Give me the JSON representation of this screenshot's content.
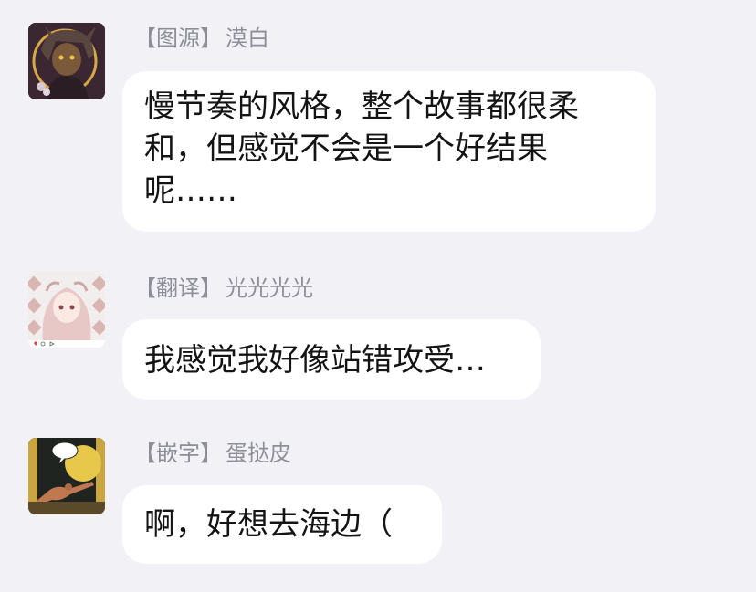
{
  "messages": [
    {
      "role_tag": "【图源】",
      "name": "漠白",
      "text": "慢节奏的风格，整个故事都很柔和，但感觉不会是一个好结果呢……",
      "avatar": "avatar-dark-hair-character-icon"
    },
    {
      "role_tag": "【翻译】",
      "name": "光光光光",
      "text": "我感觉我好像站错攻受…",
      "avatar": "avatar-pink-hair-character-icon"
    },
    {
      "role_tag": "【嵌字】",
      "name": "蛋挞皮",
      "text": "啊，好想去海边（",
      "avatar": "avatar-comic-figure-icon"
    }
  ],
  "colors": {
    "background": "#f1f1f6",
    "bubble": "#ffffff",
    "sender_text": "#8e8e98",
    "message_text": "#141414"
  }
}
